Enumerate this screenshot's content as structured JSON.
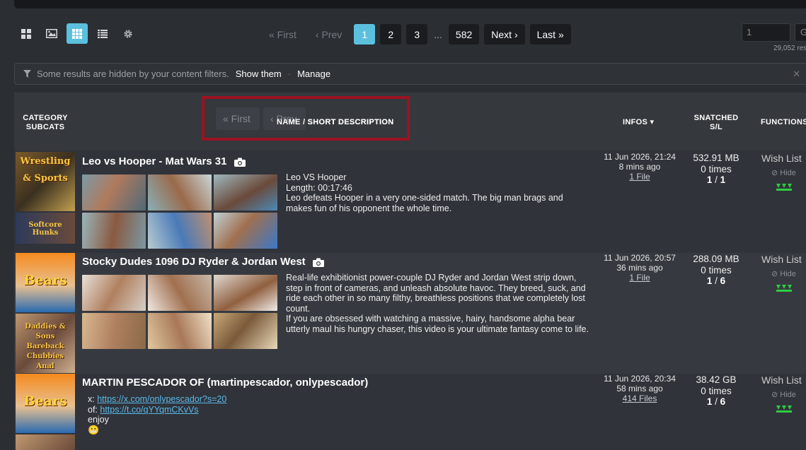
{
  "view_buttons": [
    {
      "icon": "grid-large-icon"
    },
    {
      "icon": "image-icon"
    },
    {
      "icon": "grid-small-icon",
      "active": true
    },
    {
      "icon": "list-icon"
    },
    {
      "icon": "gear-icon"
    }
  ],
  "pagination": {
    "first": "« First",
    "prev": "‹ Prev",
    "pages": [
      "1",
      "2",
      "3"
    ],
    "current": "1",
    "ellipsis": "...",
    "last_page": "582",
    "next": "Next ›",
    "last": "Last »"
  },
  "jump": {
    "value": "1",
    "go": "G",
    "results": "29,052 res"
  },
  "filter": {
    "message": "Some results are hidden by your content filters.",
    "show": "Show them",
    "separator": "·",
    "manage": "Manage"
  },
  "table_header": {
    "category_line1": "CATEGORY",
    "category_line2": "SUBCATS",
    "name": "NAME / SHORT DESCRIPTION",
    "infos": "INFOS ▾",
    "snatched_line1": "SNATCHED",
    "snatched_line2": "S/L",
    "functions": "FUNCTIONS",
    "ghost_first": "« First",
    "ghost_prev": "‹ Prev"
  },
  "rows": [
    {
      "category_tiles": [
        "Wrestling & Sports",
        "Softcore Hunks"
      ],
      "title": "Leo vs Hooper - Mat Wars 31",
      "description": [
        "Leo VS Hooper",
        "Length: 00:17:46",
        "Leo defeats Hooper in a very one-sided match. The big man brags and makes fun of his opponent the whole time."
      ],
      "date": "11 Jun 2026, 21:24",
      "ago": "8 mins ago",
      "files": "1 File",
      "size": "532.91 MB",
      "times": "0 times",
      "seed": "1",
      "slash": " / ",
      "leech": "1",
      "wishlist": "Wish List",
      "hide": "Hide"
    },
    {
      "category_tiles": [
        "Bears",
        "Daddies & Sons Bareback Chubbies Anal"
      ],
      "title": "Stocky Dudes 1096 DJ Ryder & Jordan West",
      "description": [
        "Real-life exhibitionist power-couple DJ Ryder and Jordan West strip down, step in front of cameras, and unleash absolute havoc. They breed, suck, and ride each other in so many filthy, breathless positions that we completely lost count.",
        "If you are obsessed with watching a massive, hairy, handsome alpha bear utterly maul his hungry chaser, this video is your ultimate fantasy come to life."
      ],
      "date": "11 Jun 2026, 20:57",
      "ago": "36 mins ago",
      "files": "1 File",
      "size": "288.09 MB",
      "times": "0 times",
      "seed": "1",
      "slash": " / ",
      "leech": "6",
      "wishlist": "Wish List",
      "hide": "Hide"
    },
    {
      "category_tiles": [
        "Bears"
      ],
      "title": "MARTIN PESCADOR OF (martinpescador, onlypescador)",
      "lines": [
        {
          "label": "x: ",
          "link": "https://x.com/onlypescador?s=20"
        },
        {
          "label": "of: ",
          "link": "https://t.co/qYYqmCKvVs"
        },
        {
          "label": "enjoy",
          "link": ""
        }
      ],
      "emoji": "😬",
      "date": "11 Jun 2026, 20:34",
      "ago": "58 mins ago",
      "files": "414 Files",
      "size": "38.42 GB",
      "times": "0 times",
      "seed": "1",
      "slash": " / ",
      "leech": "6",
      "wishlist": "Wish List",
      "hide": "Hide"
    }
  ],
  "colors": {
    "accent": "#5bc0de",
    "highlight_box": "#9b1320",
    "green_arrows": "#2ecc40"
  }
}
